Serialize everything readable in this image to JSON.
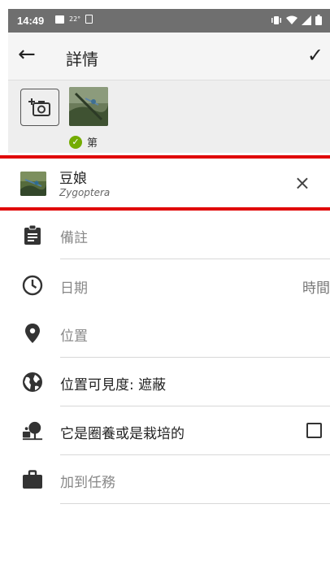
{
  "status_bar": {
    "time": "14:49",
    "temperature": "22°",
    "right_icons": "vibrate wifi signal battery"
  },
  "app_bar": {
    "back_icon": "←",
    "title": "詳情",
    "confirm_icon": "✓"
  },
  "photos": {
    "add_photo_icon": "add-photo",
    "badge_label": "第"
  },
  "taxon": {
    "common_name": "豆娘",
    "scientific_name": "Zygoptera",
    "remove_icon": "×"
  },
  "fields": {
    "notes_placeholder": "備註",
    "date_label": "日期",
    "time_label": "時間",
    "location_label": "位置",
    "geoprivacy_label": "位置可見度: 遮蔽",
    "captive_label": "它是圈養或是栽培的",
    "add_to_project_label": "加到任務"
  },
  "colors": {
    "accent_green": "#74ac00",
    "highlight_red": "#e00000",
    "app_bar_bg": "#f5f5f5",
    "photo_strip_bg": "#eeeeee"
  }
}
